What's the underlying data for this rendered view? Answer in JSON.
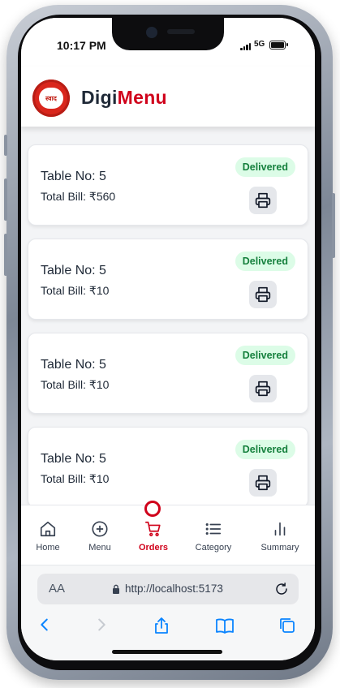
{
  "status_bar": {
    "time": "10:17 PM",
    "network": "5G"
  },
  "header": {
    "logo_text": "स्वाद",
    "brand_first": "Digi",
    "brand_second": "Menu"
  },
  "orders": [
    {
      "table_label": "Table No: 5",
      "bill_label": "Total Bill: ₹560",
      "status": "Delivered"
    },
    {
      "table_label": "Table No: 5",
      "bill_label": "Total Bill: ₹10",
      "status": "Delivered"
    },
    {
      "table_label": "Table No: 5",
      "bill_label": "Total Bill: ₹10",
      "status": "Delivered"
    },
    {
      "table_label": "Table No: 5",
      "bill_label": "Total Bill: ₹10",
      "status": "Delivered"
    }
  ],
  "nav": {
    "items": [
      {
        "label": "Home",
        "icon": "home-icon"
      },
      {
        "label": "Menu",
        "icon": "plus-circle-icon"
      },
      {
        "label": "Orders",
        "icon": "cart-icon"
      },
      {
        "label": "Category",
        "icon": "list-icon"
      },
      {
        "label": "Summary",
        "icon": "bar-chart-icon"
      }
    ],
    "active": "Orders"
  },
  "browser": {
    "text_size_label": "AA",
    "url": "http://localhost:5173"
  },
  "colors": {
    "brand_red": "#d0021b",
    "badge_bg": "#dcfce7",
    "badge_text": "#15803d",
    "text_dark": "#1f2937"
  }
}
